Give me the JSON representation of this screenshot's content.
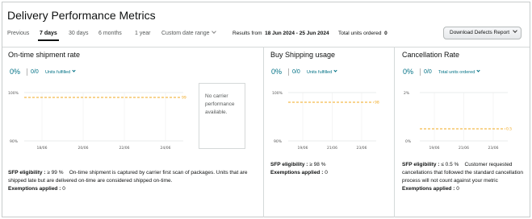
{
  "title": "Delivery Performance Metrics",
  "tabs": [
    "Previous",
    "7 days",
    "30 days",
    "6 months",
    "1 year",
    "Custom date range"
  ],
  "active_tab": "7 days",
  "results_label": "Results from",
  "results_range": "18 Jun 2024 - 25 Jun 2024",
  "units_label": "Total units ordered",
  "units_value": "0",
  "download_label": "Download Defects Report",
  "colors": {
    "link": "#007185",
    "target_line": "#f0a81f",
    "border": "#d5d9d9"
  },
  "panels": {
    "ontime": {
      "title": "On-time shipment rate",
      "pct": "0%",
      "ratio": "0/0",
      "selector": "Units fulfilled",
      "no_carrier": "No carrier performance available.",
      "eligibility_label": "SFP eligibility :",
      "eligibility_value": "≥ 99 %",
      "note": "On-time shipment is captured by carrier first scan of packages. Units that are shipped late but are delivered on-time are considered shipped on-time.",
      "exemptions_label": "Exemptions applied :",
      "exemptions_value": "0"
    },
    "buyship": {
      "title": "Buy Shipping usage",
      "pct": "0%",
      "ratio": "0/0",
      "selector": "Units fulfilled",
      "eligibility_label": "SFP eligibility :",
      "eligibility_value": "≥ 98 %",
      "exemptions_label": "Exemptions applied :",
      "exemptions_value": "0"
    },
    "cancel": {
      "title": "Cancellation Rate",
      "pct": "0%",
      "ratio": "0/0",
      "selector": "Total units ordered",
      "eligibility_label": "SFP eligibility :",
      "eligibility_value": "≤ 0.5 %",
      "note": "Customer requested cancellations that followed the standard cancellation process will not count against your metric",
      "exemptions_label": "Exemptions applied :",
      "exemptions_value": "0"
    }
  },
  "chart_data": [
    {
      "type": "line",
      "panel": "On-time shipment rate",
      "x": [
        "18/06",
        "20/06",
        "22/06",
        "24/06"
      ],
      "ylim": [
        90,
        100
      ],
      "y_ticks": [
        "100%",
        "90%"
      ],
      "target": 99,
      "target_label": "99",
      "series": []
    },
    {
      "type": "line",
      "panel": "Buy Shipping usage",
      "x": [
        "19/06",
        "21/06",
        "23/06"
      ],
      "ylim": [
        90,
        100
      ],
      "y_ticks": [
        "100%",
        "90%"
      ],
      "target": 98,
      "target_label": "98",
      "series": []
    },
    {
      "type": "line",
      "panel": "Cancellation Rate",
      "x": [
        "19/06",
        "21/06",
        "23/06"
      ],
      "ylim": [
        0,
        2
      ],
      "y_ticks": [
        "2%",
        "0%"
      ],
      "target": 0.5,
      "target_label": "0.5",
      "series": []
    }
  ]
}
